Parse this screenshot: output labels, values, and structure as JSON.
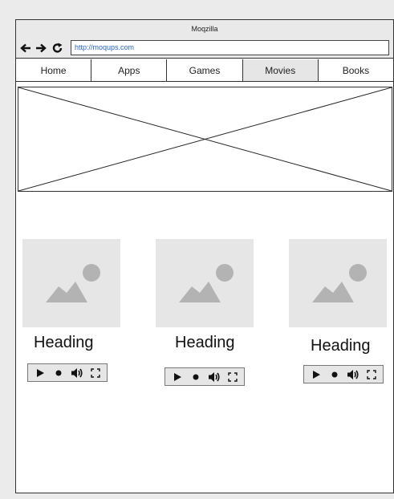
{
  "window": {
    "title": "Moqzilla",
    "url": "http://moqups.com"
  },
  "icons": {
    "back": "back-arrow-icon",
    "forward": "forward-arrow-icon",
    "reload": "reload-icon"
  },
  "tabs": [
    {
      "label": "Home",
      "active": false
    },
    {
      "label": "Apps",
      "active": false
    },
    {
      "label": "Games",
      "active": false
    },
    {
      "label": "Movies",
      "active": true
    },
    {
      "label": "Books",
      "active": false
    }
  ],
  "cards": [
    {
      "heading": "Heading"
    },
    {
      "heading": "Heading"
    },
    {
      "heading": "Heading"
    }
  ],
  "colors": {
    "placeholder_bg": "#e6e6e6",
    "placeholder_icon": "#b3b3b3",
    "url_text": "#2a66c6",
    "active_tab": "#e6e6e6"
  }
}
